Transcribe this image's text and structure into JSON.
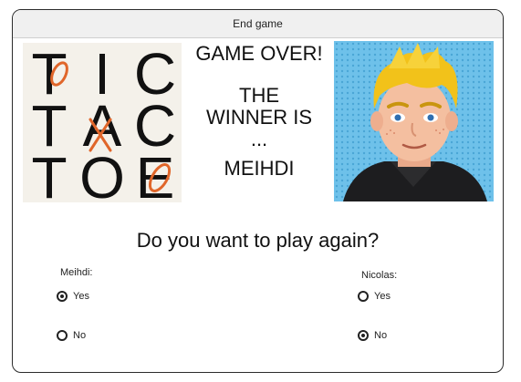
{
  "window": {
    "title": "End game"
  },
  "headline": {
    "line1": "GAME OVER!",
    "line2": "THE",
    "line3": "WINNER IS",
    "line4": "...",
    "line5": "MEIHDI"
  },
  "logo": {
    "letters": [
      "T",
      "I",
      "C",
      "T",
      "A",
      "C",
      "T",
      "O",
      "E"
    ],
    "marks": [
      "O",
      "X",
      "O"
    ],
    "mark_color": "#e0662a"
  },
  "question": "Do you want to play again?",
  "players": [
    {
      "name": "Meihdi:",
      "options": [
        {
          "label": "Yes",
          "selected": true
        },
        {
          "label": "No",
          "selected": false
        }
      ]
    },
    {
      "name": "Nicolas:",
      "options": [
        {
          "label": "Yes",
          "selected": false
        },
        {
          "label": "No",
          "selected": true
        }
      ]
    }
  ]
}
